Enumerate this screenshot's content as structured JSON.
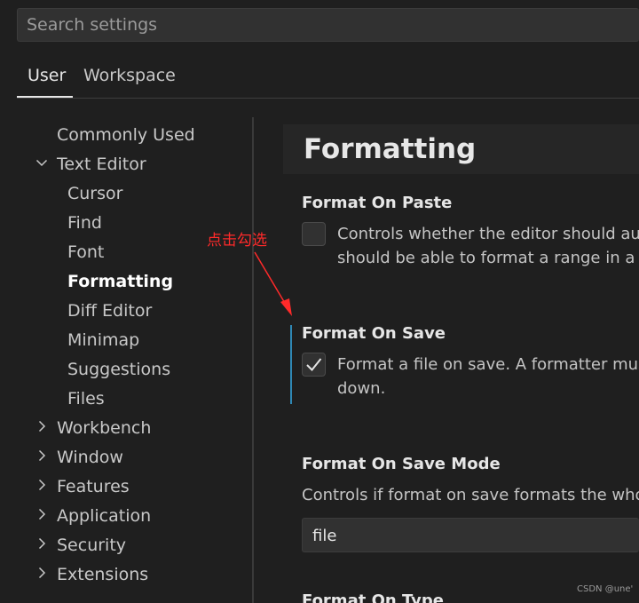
{
  "search": {
    "placeholder": "Search settings"
  },
  "scope_tabs": {
    "user": "User",
    "workspace": "Workspace"
  },
  "toc": {
    "commonly_used": "Commonly Used",
    "text_editor": "Text Editor",
    "cursor": "Cursor",
    "find": "Find",
    "font": "Font",
    "formatting": "Formatting",
    "diff_editor": "Diff Editor",
    "minimap": "Minimap",
    "suggestions": "Suggestions",
    "files": "Files",
    "workbench": "Workbench",
    "window": "Window",
    "features": "Features",
    "application": "Application",
    "security": "Security",
    "extensions": "Extensions"
  },
  "section": {
    "title": "Formatting"
  },
  "settings": {
    "format_on_paste": {
      "title": "Format On Paste",
      "desc_line1": "Controls whether the editor should auto",
      "desc_line2": "should be able to format a range in a d",
      "checked": false
    },
    "format_on_save": {
      "title": "Format On Save",
      "desc_line1": "Format a file on save. A formatter must",
      "desc_line2": "down.",
      "checked": true
    },
    "format_on_save_mode": {
      "title": "Format On Save Mode",
      "desc": "Controls if format on save formats the whole",
      "value": "file"
    },
    "format_on_type": {
      "title": "Format On Type"
    }
  },
  "annotation": {
    "text": "点击勾选",
    "color": "#ff2a2a"
  },
  "watermark": "CSDN @une'",
  "colors": {
    "background": "#1f1f1f",
    "focus_bar": "#2f88b5",
    "section_header": "#262626"
  },
  "icons": {
    "expanded": "chevron-down-icon",
    "collapsed": "chevron-right-icon",
    "check": "checkmark-icon"
  }
}
